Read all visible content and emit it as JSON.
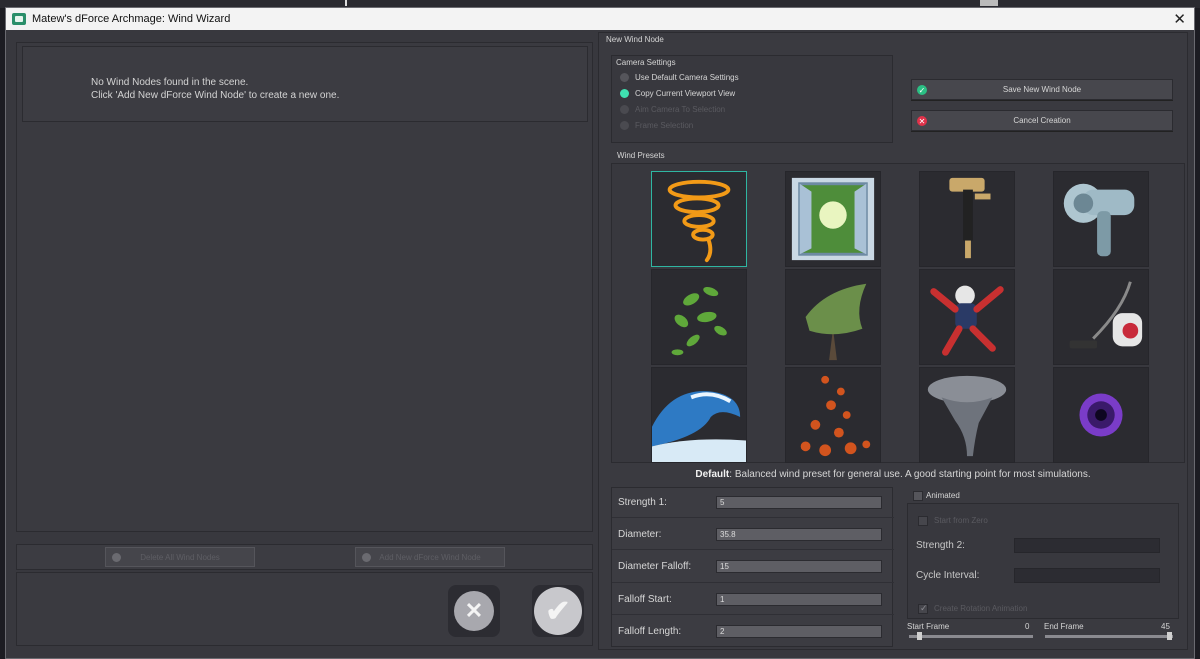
{
  "window": {
    "title": "Matew's dForce Archmage: Wind Wizard"
  },
  "left": {
    "message_line1": "No Wind Nodes found in the scene.",
    "message_line2": "Click 'Add New dForce Wind Node' to create a new one.",
    "delete_all_label": "Delete All Wind Nodes",
    "add_new_label": "Add New dForce Wind Node"
  },
  "right": {
    "section_label": "New Wind Node",
    "camera_settings": {
      "label": "Camera Settings",
      "options": [
        {
          "label": "Use Default Camera Settings",
          "selected": false,
          "enabled": true
        },
        {
          "label": "Copy Current Viewport View",
          "selected": true,
          "enabled": true
        },
        {
          "label": "Aim Camera To Selection",
          "selected": false,
          "enabled": false
        },
        {
          "label": "Frame Selection",
          "selected": false,
          "enabled": false
        }
      ]
    },
    "save_label": "Save New Wind Node",
    "cancel_label": "Cancel Creation",
    "presets_label": "Wind Presets",
    "presets": [
      {
        "icon": "tornado-swirl-icon",
        "selected": true
      },
      {
        "icon": "open-window-icon"
      },
      {
        "icon": "hammer-icon"
      },
      {
        "icon": "hair-dryer-icon"
      },
      {
        "icon": "leaves-icon"
      },
      {
        "icon": "windswept-tree-icon"
      },
      {
        "icon": "skydiver-icon"
      },
      {
        "icon": "vacuum-cleaner-icon"
      },
      {
        "icon": "ocean-wave-icon"
      },
      {
        "icon": "autumn-leaves-icon"
      },
      {
        "icon": "storm-tornado-icon"
      },
      {
        "icon": "vortex-icon"
      }
    ],
    "description_title": "Default",
    "description_text": ": Balanced wind preset for general use. A good starting point for most simulations.",
    "params": [
      {
        "label": "Strength 1:",
        "value": "5"
      },
      {
        "label": "Diameter:",
        "value": "35.8"
      },
      {
        "label": "Diameter Falloff:",
        "value": "15"
      },
      {
        "label": "Falloff Start:",
        "value": "1"
      },
      {
        "label": "Falloff Length:",
        "value": "2"
      }
    ],
    "animated_label": "Animated",
    "start_from_zero_label": "Start from Zero",
    "strength2_label": "Strength 2:",
    "cycle_interval_label": "Cycle Interval:",
    "create_rotation_label": "Create Rotation Animation",
    "start_frame_label": "Start Frame",
    "start_frame_value": "0",
    "end_frame_label": "End Frame",
    "end_frame_value": "45"
  },
  "colors": {
    "accent": "#3fe0b0",
    "background": "#38383e",
    "save_icon": "#2bbf84",
    "cancel_icon": "#e0324a"
  }
}
